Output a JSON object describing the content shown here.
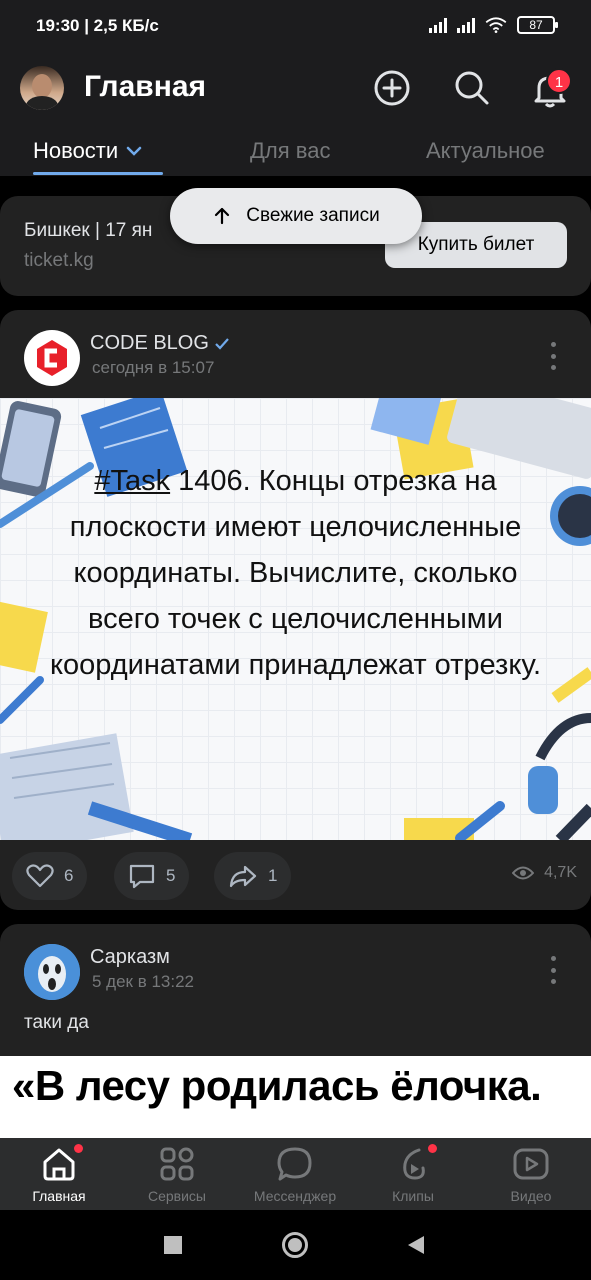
{
  "status_bar": {
    "time": "19:30 | 2,5 КБ/с",
    "battery": "87"
  },
  "header": {
    "title": "Главная",
    "notification_count": "1"
  },
  "tabs": [
    {
      "label": "Новости",
      "active": true
    },
    {
      "label": "Для вас",
      "active": false
    },
    {
      "label": "Актуальное",
      "active": false
    }
  ],
  "fresh_button": {
    "label": "Свежие записи"
  },
  "ad": {
    "title": "Бишкек | 17 ян",
    "domain": "ticket.kg",
    "button": "Купить билет"
  },
  "post1": {
    "author": "CODE BLOG",
    "date": "сегодня в 15:07",
    "image_text_tag": "#Task",
    "image_text": " 1406. Концы отрезка на плоскости имеют целочисленные координаты. Вычислите, сколько всего точек с целочисленными координатами принадлежат отрезку.",
    "likes": "6",
    "comments": "5",
    "shares": "1",
    "views": "4,7K"
  },
  "post2": {
    "author": "Сарказм",
    "date": "5 дек в 13:22",
    "text": "таки да",
    "image_text": "«В лесу родилась ёлочка."
  },
  "bottom_nav": [
    {
      "label": "Главная",
      "icon": "home-icon",
      "active": true,
      "dot": true
    },
    {
      "label": "Сервисы",
      "icon": "services-icon",
      "active": false,
      "dot": false
    },
    {
      "label": "Мессенджер",
      "icon": "messenger-icon",
      "active": false,
      "dot": false
    },
    {
      "label": "Клипы",
      "icon": "clips-icon",
      "active": false,
      "dot": true
    },
    {
      "label": "Видео",
      "icon": "video-icon",
      "active": false,
      "dot": false
    }
  ],
  "colors": {
    "accent": "#71aaeb",
    "badge": "#ff3347",
    "card": "#222222",
    "background": "#000000"
  }
}
